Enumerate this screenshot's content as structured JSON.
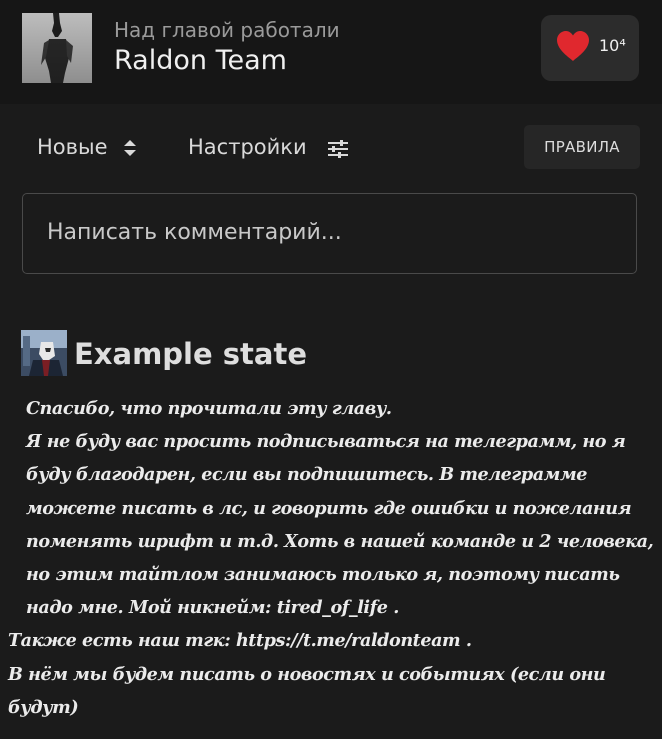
{
  "header": {
    "caption": "Над главой работали",
    "team_name": "Raldon Team",
    "likes": "10⁴",
    "heart_color": "#e0282e"
  },
  "toolbar": {
    "sort_label": "Новые",
    "settings_label": "Настройки",
    "rules_label": "ПРАВИЛА"
  },
  "comment": {
    "placeholder": "Написать комментарий..."
  },
  "note": {
    "title": "Example state",
    "lines": [
      "Спасибо, что прочитали эту главу.",
      "Я не буду вас просить подписываться на телеграмм, но я буду благодарен, если вы подпишитесь. В телеграмме можете писать в лс, и говорить где ошибки и пожелания поменять шрифт и т.д. Хоть в нашей команде и 2 человека, но этим тайтлом занимаюсь только я, поэтому писать надо мне. Мой никнейм: tired_of_life .",
      "Также есть наш тгк: https://t.me/raldonteam .",
      "В нём мы будем писать о новостях и событиях (если они будут)"
    ]
  }
}
